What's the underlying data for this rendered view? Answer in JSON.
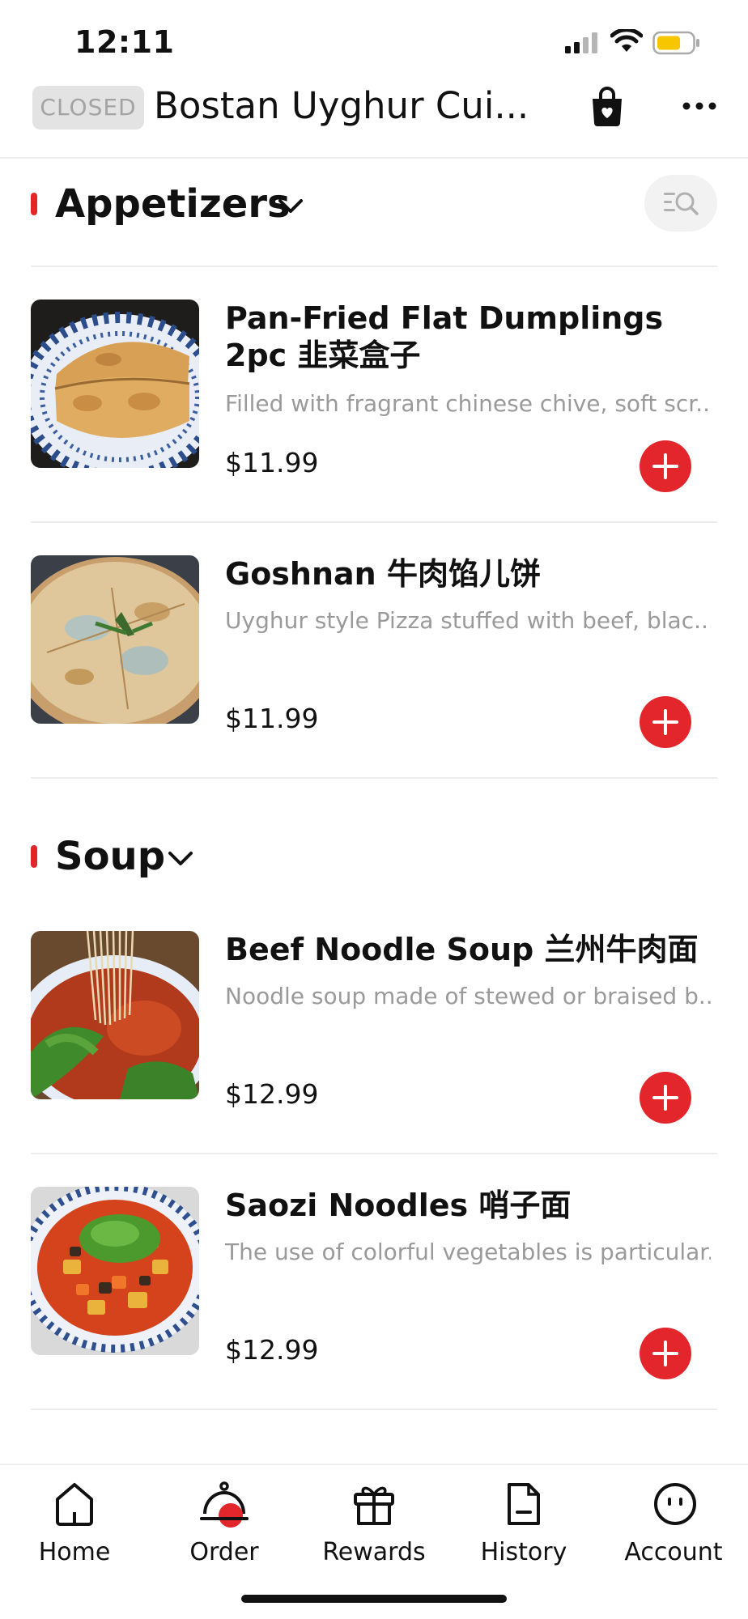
{
  "status_bar": {
    "time": "12:11"
  },
  "header": {
    "closed_badge": "CLOSED",
    "store_name": "Bostan Uyghur Cui..."
  },
  "sections": [
    {
      "title": "Appetizers",
      "items": [
        {
          "name": "Pan-Fried Flat Dumplings  2pc 韭菜盒子",
          "description": "Filled with fragrant chinese chive, soft scr...",
          "price": "$11.99"
        },
        {
          "name": "Goshnan 牛肉馅儿饼",
          "description": "Uyghur style Pizza stuffed with beef, blac...",
          "price": "$11.99"
        }
      ]
    },
    {
      "title": "Soup",
      "items": [
        {
          "name": "Beef Noodle Soup 兰州牛肉面",
          "description": "Noodle soup made of stewed or braised b...",
          "price": "$12.99"
        },
        {
          "name": "Saozi Noodles 哨子面",
          "description": "The use of colorful vegetables is particular...",
          "price": "$12.99"
        }
      ]
    }
  ],
  "tabbar": {
    "items": [
      {
        "label": "Home",
        "icon": "home-icon"
      },
      {
        "label": "Order",
        "icon": "order-cloche-icon",
        "active": true
      },
      {
        "label": "Rewards",
        "icon": "gift-icon"
      },
      {
        "label": "History",
        "icon": "receipt-icon"
      },
      {
        "label": "Account",
        "icon": "account-icon"
      }
    ]
  },
  "colors": {
    "accent": "#e3262b",
    "muted_text": "#9a9a9a",
    "badge_bg": "#e3e3e3"
  }
}
